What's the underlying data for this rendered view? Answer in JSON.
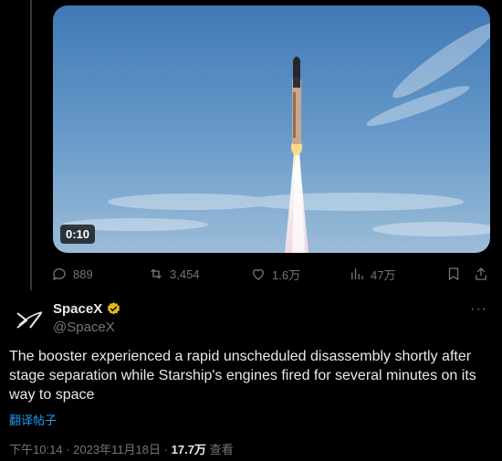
{
  "video": {
    "duration": "0:10"
  },
  "actions": {
    "replies": "889",
    "reposts": "3,454",
    "likes": "1.6万",
    "views": "47万"
  },
  "author": {
    "name": "SpaceX",
    "handle": "@SpaceX",
    "more_label": "···"
  },
  "tweet": {
    "text": "The booster experienced a rapid unscheduled disassembly shortly after stage separation while Starship's engines fired for several minutes on its way to space",
    "translate_label": "翻译帖子"
  },
  "meta": {
    "time": "下午10:14",
    "sep1": "·",
    "date": "2023年11月18日",
    "sep2": "·",
    "views_count": "17.7万",
    "views_label": "查看"
  },
  "colors": {
    "accent": "#1d9bf0",
    "verified_gold": "#e2b719",
    "muted": "#71767b",
    "text": "#e7e9ea",
    "background": "#000000"
  },
  "icons": [
    "reply-icon",
    "repost-icon",
    "like-icon",
    "views-icon",
    "bookmark-icon",
    "share-icon",
    "spacex-logo",
    "verified-badge-icon",
    "more-icon"
  ]
}
